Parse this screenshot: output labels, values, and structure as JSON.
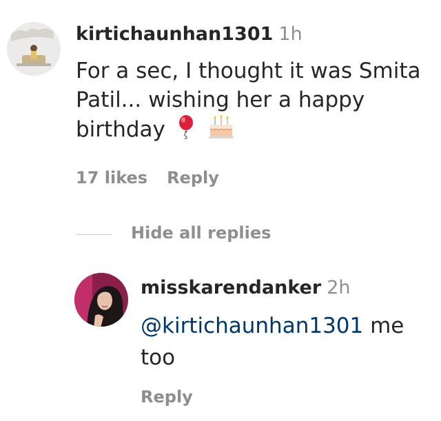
{
  "comment": {
    "username": "kirtichaunhan1301",
    "time": "1h",
    "text": "For a sec, I thought it was Smita Patil... wishing her a happy birthday",
    "likes": "17 likes",
    "reply_label": "Reply"
  },
  "replies_toggle": {
    "label": "Hide all replies"
  },
  "reply": {
    "username": "misskarendanker",
    "time": "2h",
    "mention": "@kirtichaunhan1301",
    "text": " me too",
    "reply_label": "Reply"
  },
  "emojis": [
    "balloon-icon",
    "birthday-cake-icon"
  ],
  "colors": {
    "text": "#262626",
    "muted": "#8e8e8e",
    "mention": "#00376b",
    "balloon": "#d9223a"
  }
}
